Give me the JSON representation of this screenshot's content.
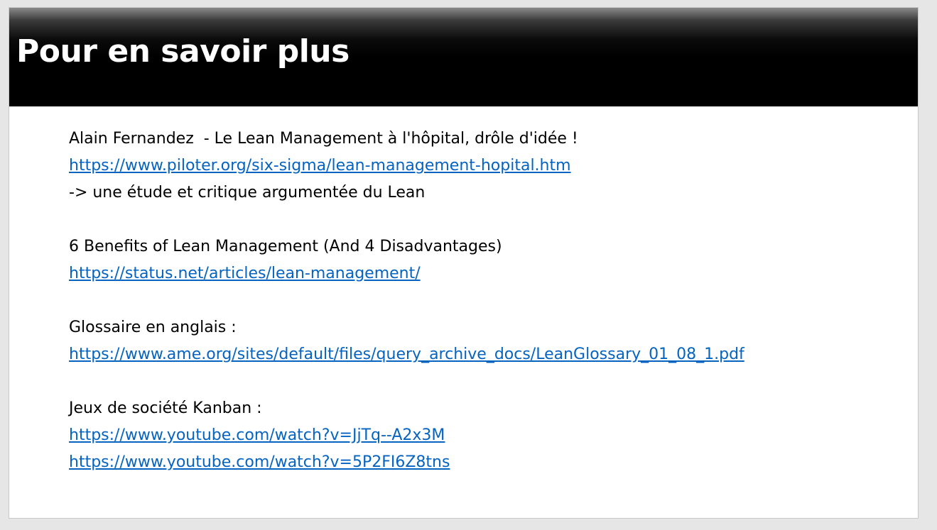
{
  "slide": {
    "title": "Pour en savoir plus",
    "sections": [
      {
        "lines": [
          {
            "type": "text",
            "value": "Alain Fernandez  - Le Lean Management à l'hôpital, drôle d'idée !"
          },
          {
            "type": "link",
            "value": "https://www.piloter.org/six-sigma/lean-management-hopital.htm"
          },
          {
            "type": "text",
            "value": "-> une étude et critique argumentée du Lean"
          }
        ]
      },
      {
        "lines": [
          {
            "type": "text",
            "value": "6 Benefits of Lean Management (And 4 Disadvantages)"
          },
          {
            "type": "link",
            "value": "https://status.net/articles/lean-management/"
          }
        ]
      },
      {
        "lines": [
          {
            "type": "text",
            "value": "Glossaire en anglais :"
          },
          {
            "type": "link",
            "value": "https://www.ame.org/sites/default/files/query_archive_docs/LeanGlossary_01_08_1.pdf"
          }
        ]
      },
      {
        "lines": [
          {
            "type": "text",
            "value": "Jeux de société Kanban :"
          },
          {
            "type": "link",
            "value": "https://www.youtube.com/watch?v=JjTq--A2x3M"
          },
          {
            "type": "link",
            "value": "https://www.youtube.com/watch?v=5P2FI6Z8tns"
          }
        ]
      }
    ]
  },
  "colors": {
    "link": "#0563c1",
    "title_bar": "#000000",
    "title_text": "#ffffff"
  }
}
